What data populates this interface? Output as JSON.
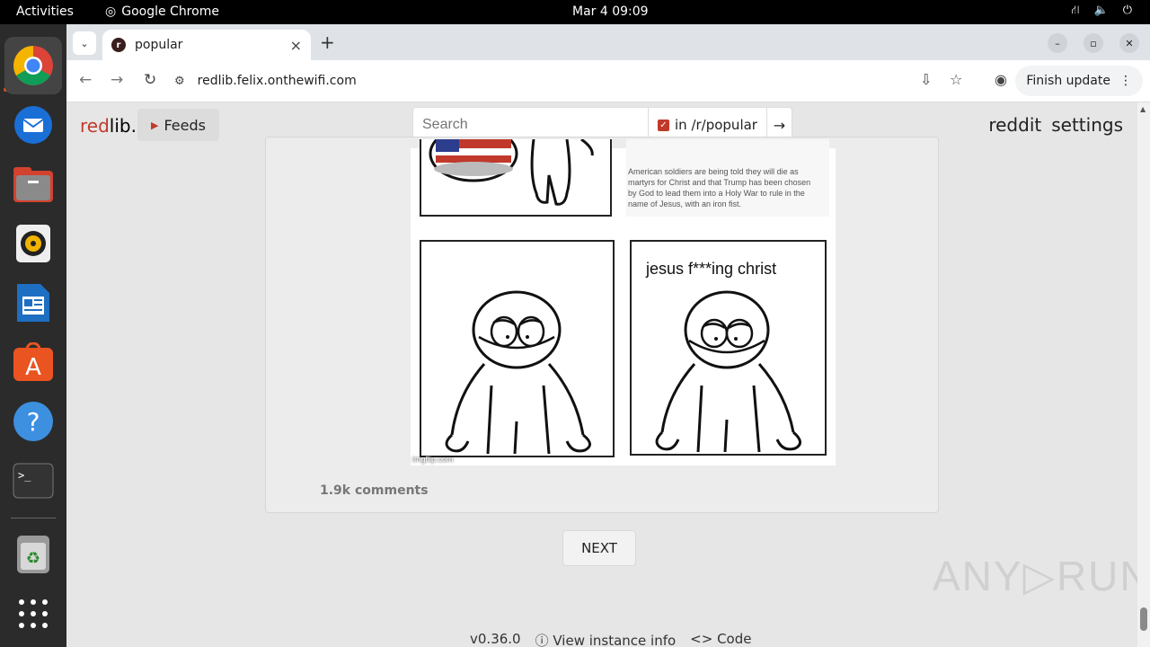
{
  "topbar": {
    "activities": "Activities",
    "app_name": "Google Chrome",
    "clock": "Mar 4  09:09"
  },
  "dock": {
    "items": [
      "chrome-icon",
      "thunderbird-icon",
      "files-icon",
      "rhythmbox-icon",
      "writer-icon",
      "app-center-icon",
      "help-icon",
      "terminal-icon",
      "trash-icon",
      "app-grid-icon"
    ]
  },
  "browser": {
    "tab_title": "popular",
    "url": "redlib.felix.onthewifi.com",
    "finish_update": "Finish update"
  },
  "redlib": {
    "logo_red": "red",
    "logo_rest": "lib.",
    "feeds_label": "Feeds",
    "search_placeholder": "Search",
    "restrict_label": "in /r/popular",
    "nav_reddit": "reddit",
    "nav_settings": "settings"
  },
  "post": {
    "news_text": "American soldiers are being told they will die as martyrs for Christ and that Trump has been chosen by God to lead them into a Holy War to rule in the name of Jesus, with an iron fist.",
    "panel_caption": "jesus f***ing christ",
    "watermark": "imgflip.com",
    "comments": "1.9k comments"
  },
  "pager": {
    "next_label": "NEXT"
  },
  "footer": {
    "version": "v0.36.0",
    "instance_info": "ⓘ View instance info",
    "code": "<> Code"
  },
  "overlay": {
    "watermark": "ANY▷RUN"
  }
}
